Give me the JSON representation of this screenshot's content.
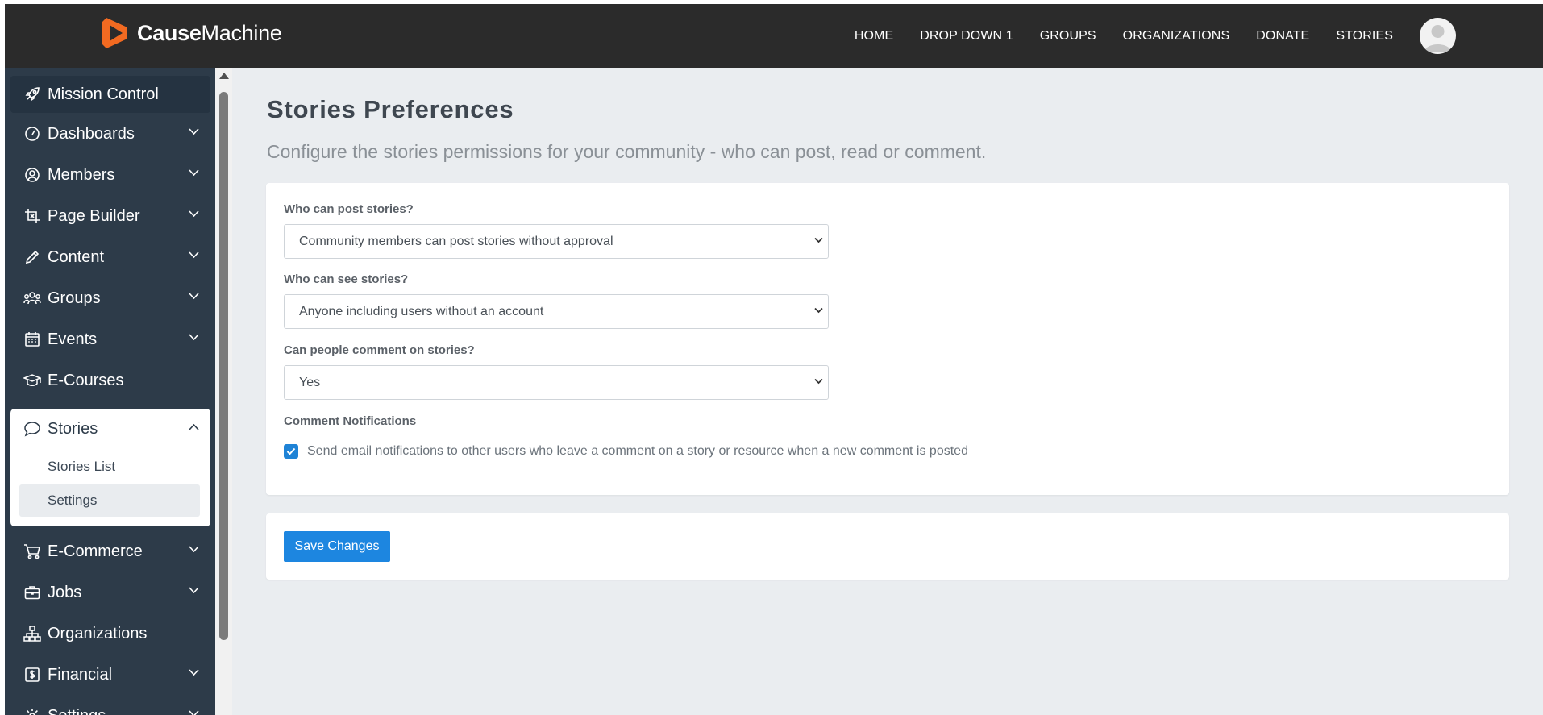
{
  "brand": {
    "name_bold": "Cause",
    "name_regular": "Machine",
    "accent": "#f26a21"
  },
  "topnav": {
    "items": [
      "HOME",
      "DROP DOWN 1",
      "GROUPS",
      "ORGANIZATIONS",
      "DONATE",
      "STORIES"
    ],
    "avatar_icon": "user-avatar-icon"
  },
  "sidebar": {
    "items": [
      {
        "label": "Mission Control",
        "icon": "rocket-icon",
        "has_chevron": false
      },
      {
        "label": "Dashboards",
        "icon": "gauge-icon",
        "has_chevron": true
      },
      {
        "label": "Members",
        "icon": "user-circle-icon",
        "has_chevron": true
      },
      {
        "label": "Page Builder",
        "icon": "crop-icon",
        "has_chevron": true
      },
      {
        "label": "Content",
        "icon": "pencil-icon",
        "has_chevron": true
      },
      {
        "label": "Groups",
        "icon": "people-icon",
        "has_chevron": true
      },
      {
        "label": "Events",
        "icon": "calendar-icon",
        "has_chevron": true
      },
      {
        "label": "E-Courses",
        "icon": "mortarboard-icon",
        "has_chevron": false
      },
      {
        "label": "Stories",
        "icon": "speech-bubble-icon",
        "has_chevron": true,
        "expanded": true,
        "children": [
          "Stories List",
          "Settings"
        ],
        "active_child": "Settings"
      },
      {
        "label": "E-Commerce",
        "icon": "cart-icon",
        "has_chevron": true
      },
      {
        "label": "Jobs",
        "icon": "briefcase-icon",
        "has_chevron": true
      },
      {
        "label": "Organizations",
        "icon": "org-chart-icon",
        "has_chevron": false
      },
      {
        "label": "Financial",
        "icon": "dollar-receipt-icon",
        "has_chevron": true
      },
      {
        "label": "Settings",
        "icon": "gear-icon",
        "has_chevron": true
      }
    ]
  },
  "main": {
    "title": "Stories Preferences",
    "subtitle": "Configure the stories permissions for your community - who can post, read or comment.",
    "fields": [
      {
        "label": "Who can post stories?",
        "value": "Community members can post stories without approval"
      },
      {
        "label": "Who can see stories?",
        "value": "Anyone including users without an account"
      },
      {
        "label": "Can people comment on stories?",
        "value": "Yes"
      }
    ],
    "notifications": {
      "label": "Comment Notifications",
      "checkbox_checked": true,
      "checkbox_text": "Send email notifications to other users who leave a comment on a story or resource when a new comment is posted"
    },
    "save_label": "Save Changes",
    "button_color": "#1d86e0"
  }
}
